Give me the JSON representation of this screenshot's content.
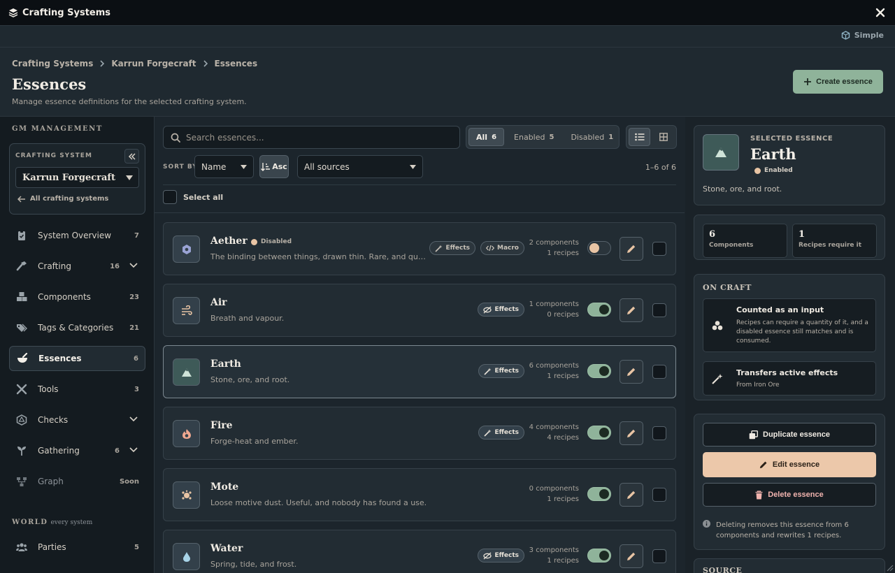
{
  "window": {
    "title": "Crafting Systems",
    "mode_label": "Simple"
  },
  "breadcrumb": [
    "Crafting Systems",
    "Karrun Forgecraft",
    "Essences"
  ],
  "header": {
    "title": "Essences",
    "subtitle": "Manage essence definitions for the selected crafting system.",
    "create_label": "Create essence"
  },
  "sidebar": {
    "section_label": "GM MANAGEMENT",
    "crafting_system_label": "CRAFTING SYSTEM",
    "crafting_system_value": "Karrun Forgecraft",
    "all_systems_link": "All crafting systems",
    "items": [
      {
        "label": "System Overview",
        "count": "7",
        "icon": "clipboard-icon"
      },
      {
        "label": "Crafting",
        "count": "16",
        "icon": "hammer-icon",
        "expandable": true
      },
      {
        "label": "Components",
        "count": "23",
        "icon": "boxes-icon"
      },
      {
        "label": "Tags & Categories",
        "count": "21",
        "icon": "tags-icon"
      },
      {
        "label": "Essences",
        "count": "6",
        "icon": "mortar-icon",
        "active": true
      },
      {
        "label": "Tools",
        "count": "3",
        "icon": "tools-icon"
      },
      {
        "label": "Checks",
        "count": "",
        "icon": "dice-icon",
        "expandable": true
      },
      {
        "label": "Gathering",
        "count": "6",
        "icon": "seedling-icon",
        "expandable": true
      },
      {
        "label": "Graph",
        "count": "Soon",
        "icon": "graph-icon",
        "dim": true
      }
    ],
    "world_label": "WORLD",
    "world_sub": "every system",
    "world_items": [
      {
        "label": "Parties",
        "count": "5",
        "icon": "users-icon"
      }
    ]
  },
  "toolbar": {
    "search_placeholder": "Search essences...",
    "filters": [
      {
        "label": "All",
        "count": "6",
        "active": true
      },
      {
        "label": "Enabled",
        "count": "5"
      },
      {
        "label": "Disabled",
        "count": "1"
      }
    ],
    "sort_label": "SORT BY",
    "sort_value": "Name",
    "order_label": "Asc",
    "source_value": "All sources",
    "range": "1–6 of 6",
    "select_all": "Select all"
  },
  "essences": [
    {
      "name": "Aether",
      "status": "Disabled",
      "desc": "The binding between things, drawn thin. Rare, and quiet...",
      "tags": [
        {
          "label": "Effects",
          "icon": "wand-icon"
        },
        {
          "label": "Macro",
          "icon": "code-icon"
        }
      ],
      "components": "2 components",
      "recipes": "1 recipes",
      "enabled": false,
      "icon": "aether-icon"
    },
    {
      "name": "Air",
      "status": "",
      "desc": "Breath and vapour.",
      "tags": [
        {
          "label": "Effects",
          "icon": "no-effects-icon",
          "lit": true
        }
      ],
      "components": "1 components",
      "recipes": "0 recipes",
      "enabled": true,
      "icon": "wind-icon"
    },
    {
      "name": "Earth",
      "status": "",
      "desc": "Stone, ore, and root.",
      "tags": [
        {
          "label": "Effects",
          "icon": "wand-icon",
          "lit": true
        }
      ],
      "components": "6 components",
      "recipes": "1 recipes",
      "enabled": true,
      "icon": "mountain-icon",
      "selected": true
    },
    {
      "name": "Fire",
      "status": "",
      "desc": "Forge-heat and ember.",
      "tags": [
        {
          "label": "Effects",
          "icon": "wand-icon",
          "lit": true
        }
      ],
      "components": "4 components",
      "recipes": "4 recipes",
      "enabled": true,
      "icon": "flame-icon"
    },
    {
      "name": "Mote",
      "status": "",
      "desc": "Loose motive dust. Useful, and nobody has found a use.",
      "tags": [],
      "components": "0 components",
      "recipes": "1 recipes",
      "enabled": true,
      "icon": "mote-icon"
    },
    {
      "name": "Water",
      "status": "",
      "desc": "Spring, tide, and frost.",
      "tags": [
        {
          "label": "Effects",
          "icon": "no-effects-icon",
          "lit": true
        }
      ],
      "components": "3 components",
      "recipes": "1 recipes",
      "enabled": true,
      "icon": "droplet-icon"
    }
  ],
  "detail": {
    "label": "SELECTED ESSENCE",
    "name": "Earth",
    "status": "Enabled",
    "desc": "Stone, ore, and root.",
    "stats": [
      {
        "value": "6",
        "label": "Components"
      },
      {
        "value": "1",
        "label": "Recipes require it"
      }
    ],
    "on_craft_title": "ON CRAFT",
    "on_craft": [
      {
        "title": "Counted as an input",
        "desc": "Recipes can require a quantity of it, and a disabled essence still matches and is consumed."
      },
      {
        "title": "Transfers active effects",
        "desc": "From Iron Ore"
      }
    ],
    "duplicate_label": "Duplicate essence",
    "edit_label": "Edit essence",
    "delete_label": "Delete essence",
    "delete_note": "Deleting removes this essence from 6 components and rewrites 1 recipes.",
    "source_title": "SOURCE"
  },
  "colors": {
    "accent_green": "#8fb39a",
    "accent_peach": "#ecc8aa",
    "danger": "#f0b3ae"
  }
}
